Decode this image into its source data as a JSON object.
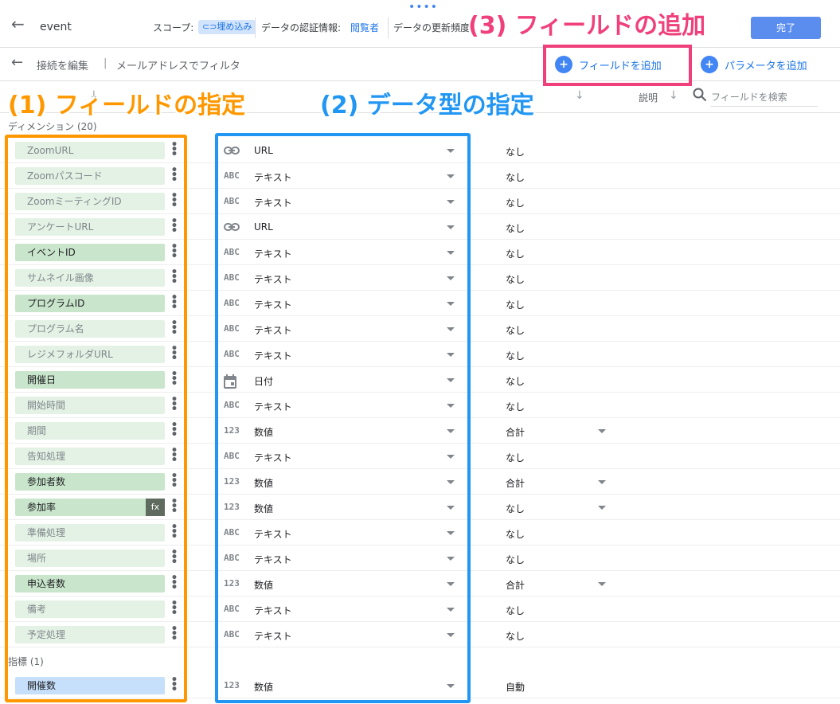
{
  "header": {
    "title": "event",
    "scope_label": "スコープ:",
    "scope_chip": "⊂⊃埋め込み",
    "credentials_label": "データの認証情報:",
    "credentials_value": "閲覧者",
    "freshness_label": "データの更新頻度",
    "done_label": "完了"
  },
  "subbar": {
    "edit_connection": "接続を編集",
    "separator": "|",
    "filter_label": "メールアドレスでフィルタ",
    "add_field": "フィールドを追加",
    "add_parameter": "パラメータを追加"
  },
  "columns": {
    "description": "説明",
    "search_placeholder": "フィールドを検索"
  },
  "sections": {
    "dimensions": "ディメンション (20)",
    "metrics": "指標 (1)"
  },
  "dimensions": [
    {
      "name": "ZoomURL",
      "style": "dim",
      "type_icon": "link-icon",
      "type": "URL",
      "agg": "なし",
      "agg_dropdown": false
    },
    {
      "name": "Zoomパスコード",
      "style": "dim",
      "type_icon": "text-icon",
      "type": "テキスト",
      "agg": "なし",
      "agg_dropdown": false
    },
    {
      "name": "ZoomミーティングID",
      "style": "dim",
      "type_icon": "text-icon",
      "type": "テキスト",
      "agg": "なし",
      "agg_dropdown": false
    },
    {
      "name": "アンケートURL",
      "style": "dim",
      "type_icon": "link-icon",
      "type": "URL",
      "agg": "なし",
      "agg_dropdown": false
    },
    {
      "name": "イベントID",
      "style": "dark",
      "type_icon": "text-icon",
      "type": "テキスト",
      "agg": "なし",
      "agg_dropdown": false
    },
    {
      "name": "サムネイル画像",
      "style": "dim",
      "type_icon": "text-icon",
      "type": "テキスト",
      "agg": "なし",
      "agg_dropdown": false
    },
    {
      "name": "プログラムID",
      "style": "dark",
      "type_icon": "text-icon",
      "type": "テキスト",
      "agg": "なし",
      "agg_dropdown": false
    },
    {
      "name": "プログラム名",
      "style": "dim",
      "type_icon": "text-icon",
      "type": "テキスト",
      "agg": "なし",
      "agg_dropdown": false
    },
    {
      "name": "レジメフォルダURL",
      "style": "dim",
      "type_icon": "text-icon",
      "type": "テキスト",
      "agg": "なし",
      "agg_dropdown": false
    },
    {
      "name": "開催日",
      "style": "dark",
      "type_icon": "calendar-icon",
      "type": "日付",
      "agg": "なし",
      "agg_dropdown": false
    },
    {
      "name": "開始時間",
      "style": "dim",
      "type_icon": "text-icon",
      "type": "テキスト",
      "agg": "なし",
      "agg_dropdown": false
    },
    {
      "name": "期間",
      "style": "dim",
      "type_icon": "number-icon",
      "type": "数値",
      "agg": "合計",
      "agg_dropdown": true
    },
    {
      "name": "告知処理",
      "style": "dim",
      "type_icon": "text-icon",
      "type": "テキスト",
      "agg": "なし",
      "agg_dropdown": false
    },
    {
      "name": "参加者数",
      "style": "dark",
      "type_icon": "number-icon",
      "type": "数値",
      "agg": "合計",
      "agg_dropdown": true
    },
    {
      "name": "参加率",
      "style": "dark",
      "fx": "fx",
      "type_icon": "number-icon",
      "type": "数値",
      "agg": "なし",
      "agg_dropdown": true
    },
    {
      "name": "準備処理",
      "style": "dim",
      "type_icon": "text-icon",
      "type": "テキスト",
      "agg": "なし",
      "agg_dropdown": false
    },
    {
      "name": "場所",
      "style": "dim",
      "type_icon": "text-icon",
      "type": "テキスト",
      "agg": "なし",
      "agg_dropdown": false
    },
    {
      "name": "申込者数",
      "style": "dark",
      "type_icon": "number-icon",
      "type": "数値",
      "agg": "合計",
      "agg_dropdown": true
    },
    {
      "name": "備考",
      "style": "dim",
      "type_icon": "text-icon",
      "type": "テキスト",
      "agg": "なし",
      "agg_dropdown": false
    },
    {
      "name": "予定処理",
      "style": "dim",
      "type_icon": "text-icon",
      "type": "テキスト",
      "agg": "なし",
      "agg_dropdown": false
    }
  ],
  "metrics": [
    {
      "name": "開催数",
      "style": "metric",
      "type_icon": "number-icon",
      "type": "数値",
      "agg": "自動",
      "agg_dropdown": false
    }
  ],
  "icons": {
    "text-icon": "ABC",
    "number-icon": "123"
  },
  "annotations": {
    "field_spec": "(1) フィールドの指定",
    "type_spec": "(2) データ型の指定",
    "add_field": "(3) フィールドの追加"
  },
  "colors": {
    "accent": "#1a73e8",
    "orange": "#ff9800",
    "blue": "#2196f3",
    "pink": "#f0407b"
  }
}
